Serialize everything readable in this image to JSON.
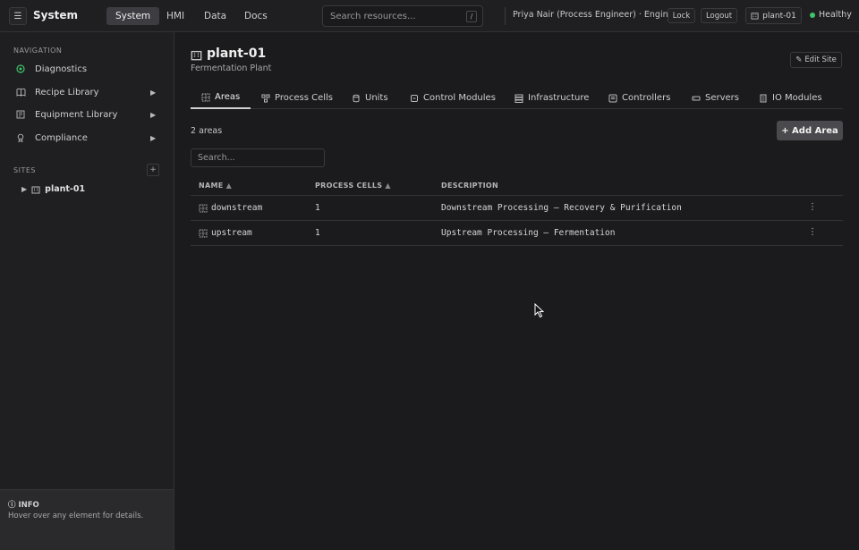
{
  "topbar": {
    "app_title": "System",
    "nav_tabs": [
      {
        "label": "System",
        "active": true
      },
      {
        "label": "HMI",
        "active": false
      },
      {
        "label": "Data",
        "active": false
      },
      {
        "label": "Docs",
        "active": false
      }
    ],
    "search_placeholder": "Search resources...",
    "search_shortcut": "/",
    "user": "Priya Nair (Process Engineer) · Engineer",
    "lock_label": "Lock",
    "logout_label": "Logout",
    "site_label": "plant-01",
    "health_label": "Healthy",
    "health_color": "#3fc46a"
  },
  "sidebar": {
    "nav_heading": "NAVIGATION",
    "items": [
      {
        "label": "Diagnostics",
        "icon": "diagnostics-icon",
        "expandable": false
      },
      {
        "label": "Recipe Library",
        "icon": "book-icon",
        "expandable": true
      },
      {
        "label": "Equipment Library",
        "icon": "equipment-icon",
        "expandable": true
      },
      {
        "label": "Compliance",
        "icon": "badge-icon",
        "expandable": true
      }
    ],
    "sites_heading": "SITES",
    "add_site_label": "+",
    "sites": [
      {
        "label": "plant-01"
      }
    ],
    "info_title": "INFO",
    "info_text": "Hover over any element for details."
  },
  "main": {
    "title": "plant-01",
    "subtitle": "Fermentation Plant",
    "edit_label": "Edit Site",
    "tabs": [
      {
        "label": "Areas",
        "icon": "grid-icon",
        "active": true
      },
      {
        "label": "Process Cells",
        "icon": "cells-icon",
        "active": false
      },
      {
        "label": "Units",
        "icon": "cylinder-icon",
        "active": false
      },
      {
        "label": "Control Modules",
        "icon": "module-icon",
        "active": false
      },
      {
        "label": "Infrastructure",
        "icon": "server-stack-icon",
        "active": false
      },
      {
        "label": "Controllers",
        "icon": "controller-icon",
        "active": false
      },
      {
        "label": "Servers",
        "icon": "server-icon",
        "active": false
      },
      {
        "label": "IO Modules",
        "icon": "io-icon",
        "active": false
      }
    ],
    "count_label": "2 areas",
    "add_label": "+ Add Area",
    "table_search_placeholder": "Search...",
    "columns": [
      {
        "label": "NAME",
        "sort": "▲"
      },
      {
        "label": "PROCESS CELLS",
        "sort": "▲"
      },
      {
        "label": "DESCRIPTION",
        "sort": ""
      }
    ],
    "rows": [
      {
        "name": "downstream",
        "process_cells": "1",
        "description": "Downstream Processing — Recovery & Purification"
      },
      {
        "name": "upstream",
        "process_cells": "1",
        "description": "Upstream Processing — Fermentation"
      }
    ]
  }
}
